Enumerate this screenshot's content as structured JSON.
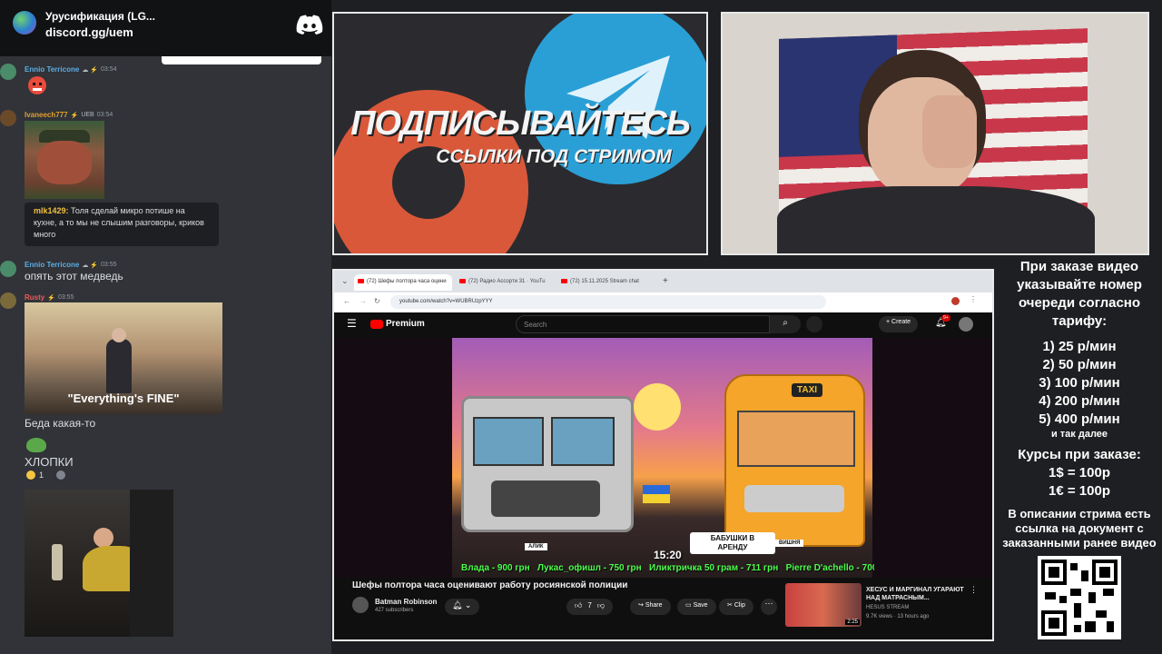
{
  "discord": {
    "server_name": "Урусификация (LG...",
    "invite": "discord.gg/uem"
  },
  "chat": {
    "messages": [
      {
        "author": "Ennio Terricone",
        "time": "03:54",
        "color": "#5dade2"
      },
      {
        "author": "Ivaneech777",
        "badge": "UEB",
        "time": "03:54",
        "color": "#e0a030"
      },
      {
        "author": "mlk1429",
        "text": "Толя сделай микро потише на кухне, а то мы не слышим разговоры, криков много"
      },
      {
        "author": "Ennio Terricone",
        "time": "03:55",
        "text": "опять этот медведь",
        "color": "#5dade2"
      },
      {
        "author": "Rusty",
        "time": "03:55",
        "text": "Беда какая-то",
        "caption": "\"Everything's FINE\"",
        "color": "#e85c5c"
      },
      {
        "text": "ХЛОПКИ",
        "reaction_count": "1"
      }
    ]
  },
  "promo": {
    "title": "ПОДПИСЫВАЙТЕСЬ",
    "subtitle": "ССЫЛКИ ПОД СТРИМОМ"
  },
  "browser": {
    "tabs": [
      {
        "label": "(72) Шефы полтора часа оцени"
      },
      {
        "label": "(72) Радио Ассорти 31 · YouTu"
      },
      {
        "label": "(72) 15.11.2025 Stream chat"
      }
    ],
    "url": "youtube.com/watch?v=WUBRUzpYYY",
    "search_placeholder": "Search",
    "brand": "Premium",
    "create_label": "Create",
    "notif_count": "9+",
    "video": {
      "time": "15:20",
      "ticker": "Влада - 900 грн   Лукас_офишл - 750 грн   Иликтричка 50 грам - 711 грн   Pierre D'achello - 700",
      "thumb_taxi": "TAXI",
      "thumb_label": "БАБУШКИ В АРЕНДУ",
      "thumb_alik": "АЛИК",
      "thumb_vishnya": "ВИШНЯ",
      "title": "Шефы полтора часа оценивают работу росиянской полиции",
      "channel": "Batman Robinson",
      "subs": "427 subscribers",
      "likes": "7",
      "share": "Share",
      "save": "Save",
      "clip": "Clip"
    },
    "rec": {
      "title": "ХЕСУС И МАРГИНАЛ УГАРАЮТ НАД МАТРАСНЫМ...",
      "channel": "HESUS STREAM",
      "meta": "9.7K views · 13 hours ago",
      "duration": "2:25"
    }
  },
  "side": {
    "heading": "При заказе видео указывайте номер очереди согласно тарифу:",
    "tariffs": [
      "1) 25 р/мин",
      "2) 50 р/мин",
      "3) 100 р/мин",
      "4) 200 р/мин",
      "5) 400 р/мин"
    ],
    "etc": "и так далее",
    "rates_title": "Курсы при заказе:",
    "rates": [
      "1$ = 100р",
      "1€ = 100р"
    ],
    "note": "В описании стрима есть ссылка на документ с заказанными ранее видео"
  }
}
